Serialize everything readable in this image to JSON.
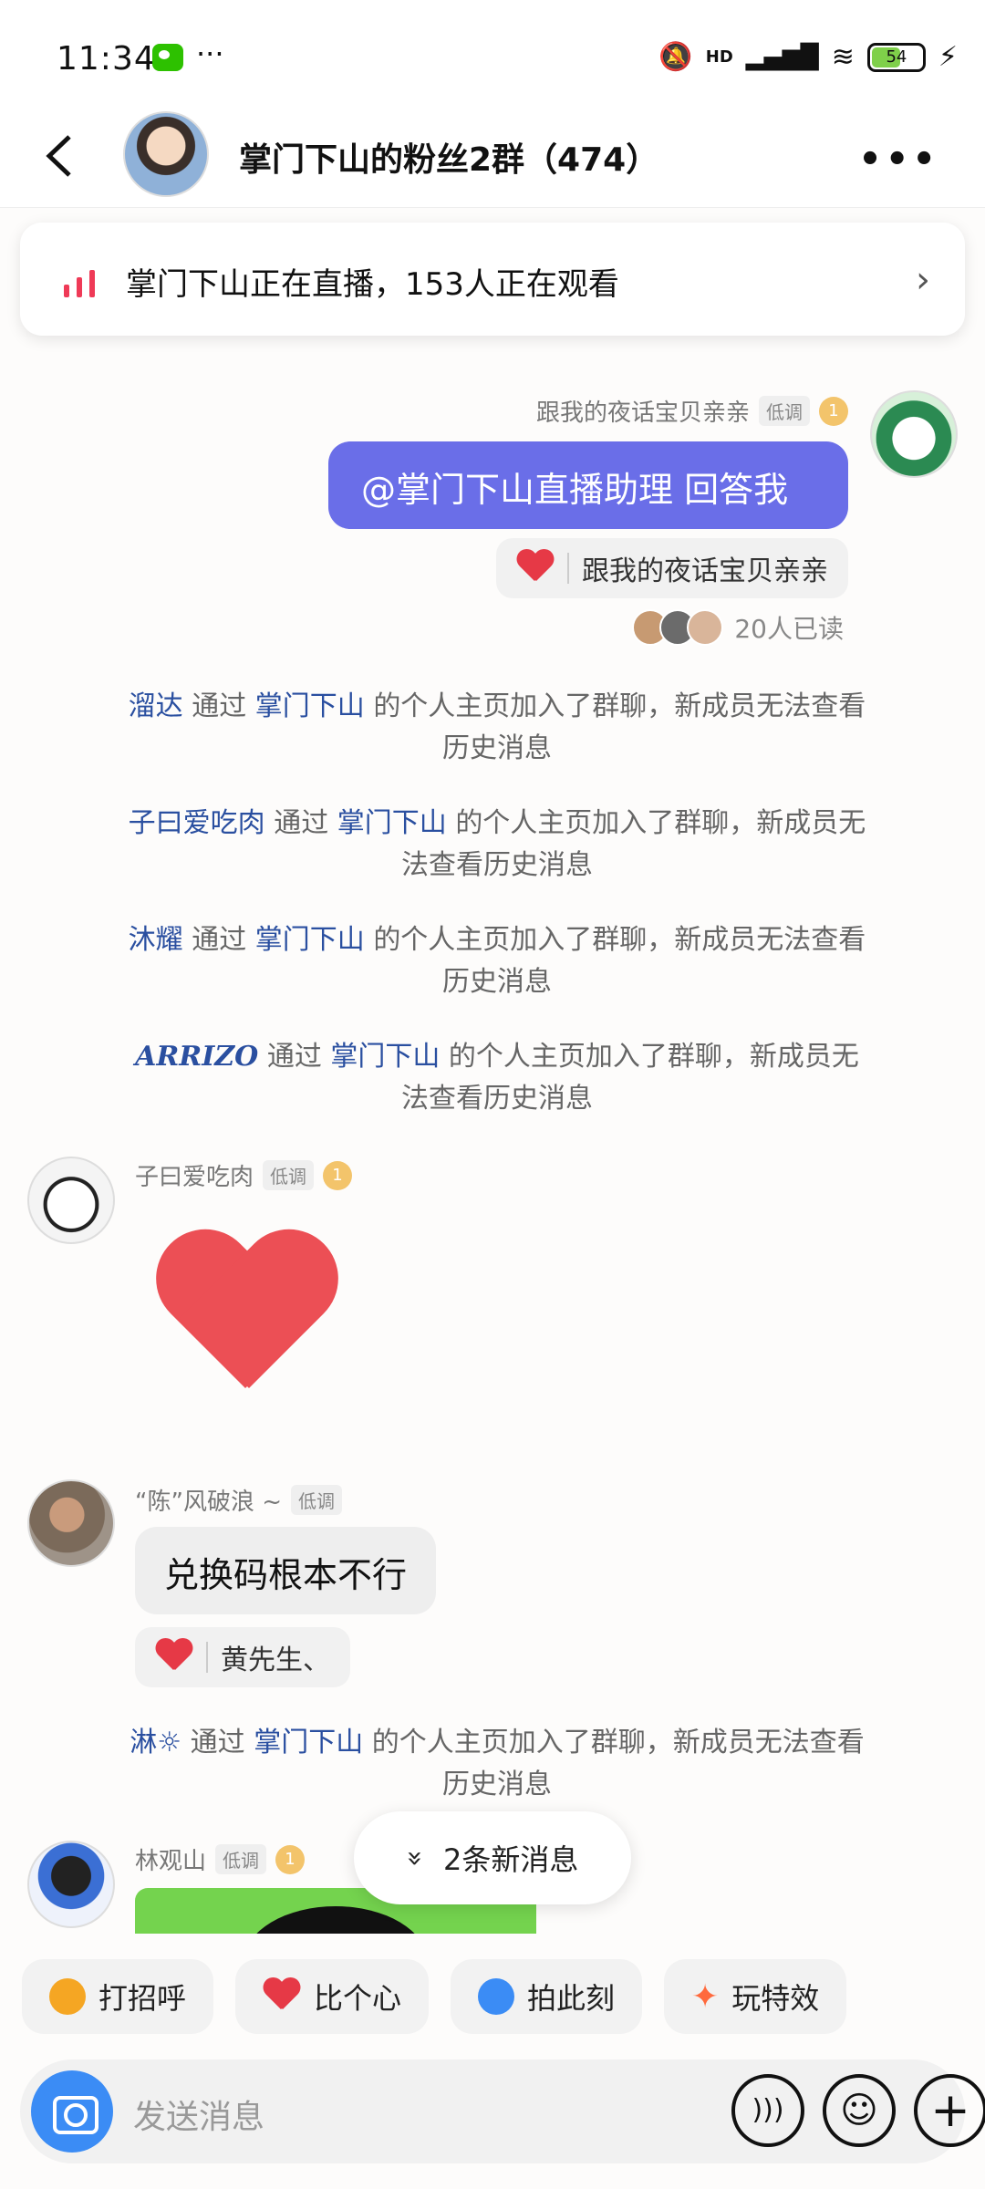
{
  "status": {
    "time": "11:34",
    "more": "···",
    "signal": "HD",
    "battery": "54"
  },
  "header": {
    "title": "掌门下山的粉丝2群（474）",
    "more": "•••"
  },
  "live_banner": {
    "text": "掌门下山正在直播，153人正在观看",
    "arrow": "›"
  },
  "msg1": {
    "sender": "跟我的夜话宝贝亲亲",
    "tag": "低调",
    "level": "1",
    "text": "@掌门下山直播助理 回答我",
    "reaction_user": "跟我的夜话宝贝亲亲",
    "read_count": "20人已读"
  },
  "system_messages": [
    {
      "name": "溜达",
      "via": "通过",
      "owner": "掌门下山",
      "rest": "的个人主页加入了群聊，新成员无法查看历史消息"
    },
    {
      "name": "子曰爱吃肉",
      "via": "通过",
      "owner": "掌门下山",
      "rest": "的个人主页加入了群聊，新成员无法查看历史消息"
    },
    {
      "name": "沐耀",
      "via": "通过",
      "owner": "掌门下山",
      "rest": "的个人主页加入了群聊，新成员无法查看历史消息"
    },
    {
      "name": "ARRIZO",
      "via": "通过",
      "owner": "掌门下山",
      "rest": "的个人主页加入了群聊，新成员无法查看历史消息"
    },
    {
      "name": "淋☼",
      "via": "通过",
      "owner": "掌门下山",
      "rest": "的个人主页加入了群聊，新成员无法查看历史消息"
    }
  ],
  "msg2": {
    "sender": "子曰爱吃肉",
    "tag": "低调",
    "level": "1"
  },
  "msg3": {
    "sender": "“陈”风破浪 ~",
    "tag": "低调",
    "text": "兑换码根本不行",
    "reaction_user": "黄先生、"
  },
  "msg4": {
    "sender": "林观山",
    "tag": "低调",
    "level": "1"
  },
  "new_messages": {
    "icon": "»",
    "text": "2条新消息"
  },
  "quick_actions": [
    {
      "label": "打招呼",
      "icon": "wave-icon",
      "color": "#f5a623"
    },
    {
      "label": "比个心",
      "icon": "heart-icon",
      "color": "#e63946"
    },
    {
      "label": "拍此刻",
      "icon": "camera-icon",
      "color": "#3b8cf5"
    },
    {
      "label": "玩特效",
      "icon": "sparkle-icon",
      "color": "#ff6a3d"
    }
  ],
  "input": {
    "placeholder": "发送消息",
    "voice": ")))",
    "emoji": "☺",
    "plus": "+"
  }
}
